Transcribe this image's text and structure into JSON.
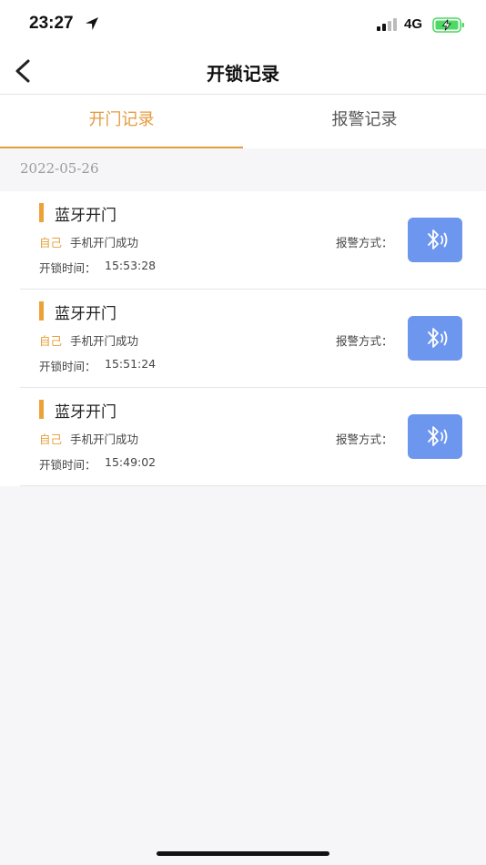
{
  "status_bar": {
    "time": "23:27",
    "network": "4G"
  },
  "nav": {
    "title": "开锁记录"
  },
  "tabs": [
    {
      "label": "开门记录",
      "active": true
    },
    {
      "label": "报警记录",
      "active": false
    }
  ],
  "date_header": "2022-05-26",
  "records": [
    {
      "title": "蓝牙开门",
      "operator": "自己",
      "result": "手机开门成功",
      "unlock_time_label": "开锁时间：",
      "unlock_time": "15:53:28",
      "alarm_label": "报警方式：",
      "method_icon": "bluetooth-icon"
    },
    {
      "title": "蓝牙开门",
      "operator": "自己",
      "result": "手机开门成功",
      "unlock_time_label": "开锁时间：",
      "unlock_time": "15:51:24",
      "alarm_label": "报警方式：",
      "method_icon": "bluetooth-icon"
    },
    {
      "title": "蓝牙开门",
      "operator": "自己",
      "result": "手机开门成功",
      "unlock_time_label": "开锁时间：",
      "unlock_time": "15:49:02",
      "alarm_label": "报警方式：",
      "method_icon": "bluetooth-icon"
    }
  ],
  "colors": {
    "accent": "#e69a3c",
    "marker": "#eda238",
    "bluetooth_button": "#6d96ef",
    "battery_fill": "#4cd964"
  }
}
